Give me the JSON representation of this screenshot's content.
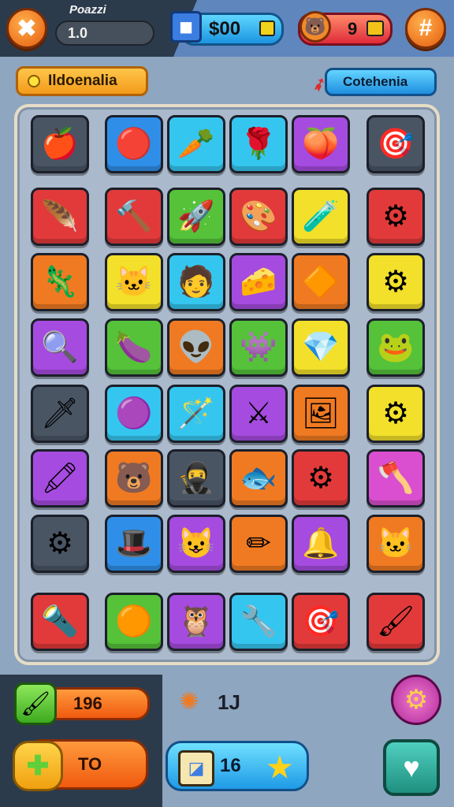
{
  "header": {
    "title": "Poazzi",
    "level_value": "1.0",
    "coins_value": "$00",
    "gems_value": "9",
    "left_button_icon": "crossed-swords-icon",
    "right_button_icon": "hash-settings-icon"
  },
  "labels": {
    "left_label": "Ildoenalia",
    "right_label": "Cotehenia"
  },
  "board": {
    "colors": {
      "red": "#e23a3a",
      "blue": "#2f8fe8",
      "cyan": "#35c6f0",
      "purple": "#a64be0",
      "green": "#55c23a",
      "yellow": "#f2e02a",
      "orange": "#f07a22",
      "gray": "#4a5564",
      "magenta": "#d94fd0"
    },
    "tiles": [
      {
        "color": "gray",
        "icon": "🍎",
        "name": "apple-icon"
      },
      {
        "color": "blue",
        "icon": "🔴",
        "name": "red-ball-icon"
      },
      {
        "color": "cyan",
        "icon": "🥕",
        "name": "carrot-brush-icon"
      },
      {
        "color": "cyan",
        "icon": "🌹",
        "name": "flower-icon"
      },
      {
        "color": "purple",
        "icon": "🍑",
        "name": "fruit-icon"
      },
      {
        "color": "gray",
        "icon": "🎯",
        "name": "target-icon"
      },
      {
        "color": "red",
        "icon": "🪶",
        "name": "feather-icon"
      },
      {
        "color": "red",
        "icon": "🔨",
        "name": "hammer-icon"
      },
      {
        "color": "green",
        "icon": "🚀",
        "name": "rocket-icon"
      },
      {
        "color": "red",
        "icon": "🎨",
        "name": "palette-icon"
      },
      {
        "color": "yellow",
        "icon": "🧪",
        "name": "potion-icon"
      },
      {
        "color": "red",
        "icon": "⚙",
        "name": "gear-icon"
      },
      {
        "color": "orange",
        "icon": "🦎",
        "name": "lizard-icon"
      },
      {
        "color": "yellow",
        "icon": "🐱",
        "name": "cat-icon"
      },
      {
        "color": "cyan",
        "icon": "🧑",
        "name": "person-icon"
      },
      {
        "color": "purple",
        "icon": "🧀",
        "name": "cheese-icon"
      },
      {
        "color": "orange",
        "icon": "🔶",
        "name": "gem-shape-icon"
      },
      {
        "color": "yellow",
        "icon": "⚙",
        "name": "blue-gear-icon"
      },
      {
        "color": "purple",
        "icon": "🔍",
        "name": "lens-icon"
      },
      {
        "color": "green",
        "icon": "🍆",
        "name": "eggplant-icon"
      },
      {
        "color": "orange",
        "icon": "👽",
        "name": "alien-icon"
      },
      {
        "color": "green",
        "icon": "👾",
        "name": "monster-icon"
      },
      {
        "color": "yellow",
        "icon": "💎",
        "name": "crystal-icon"
      },
      {
        "color": "green",
        "icon": "🐸",
        "name": "frog-icon"
      },
      {
        "color": "gray",
        "icon": "🗡",
        "name": "dagger-icon"
      },
      {
        "color": "cyan",
        "icon": "🟣",
        "name": "purple-orb-icon"
      },
      {
        "color": "cyan",
        "icon": "🪄",
        "name": "wand-icon"
      },
      {
        "color": "purple",
        "icon": "⚔",
        "name": "sword-icon"
      },
      {
        "color": "orange",
        "icon": "🖼",
        "name": "picture-icon"
      },
      {
        "color": "yellow",
        "icon": "⚙",
        "name": "dark-gear-icon"
      },
      {
        "color": "purple",
        "icon": "🖍",
        "name": "crayon-icon"
      },
      {
        "color": "orange",
        "icon": "🐻",
        "name": "bear-icon"
      },
      {
        "color": "gray",
        "icon": "🥷",
        "name": "ninja-icon"
      },
      {
        "color": "orange",
        "icon": "🐟",
        "name": "fish-icon"
      },
      {
        "color": "red",
        "icon": "⚙",
        "name": "cog-icon"
      },
      {
        "color": "magenta",
        "icon": "🪓",
        "name": "axe-icon"
      },
      {
        "color": "gray",
        "icon": "⚙",
        "name": "red-gear-icon"
      },
      {
        "color": "blue",
        "icon": "🎩",
        "name": "hat-icon"
      },
      {
        "color": "purple",
        "icon": "😺",
        "name": "purple-cat-icon"
      },
      {
        "color": "orange",
        "icon": "✏",
        "name": "pencil-icon"
      },
      {
        "color": "purple",
        "icon": "🔔",
        "name": "bell-icon"
      },
      {
        "color": "orange",
        "icon": "🐱",
        "name": "gray-cat-icon"
      },
      {
        "color": "red",
        "icon": "🔦",
        "name": "torch-icon"
      },
      {
        "color": "green",
        "icon": "🟠",
        "name": "orange-coin-icon"
      },
      {
        "color": "purple",
        "icon": "🦉",
        "name": "owl-icon"
      },
      {
        "color": "cyan",
        "icon": "🔧",
        "name": "wrench-icon"
      },
      {
        "color": "red",
        "icon": "🎯",
        "name": "orange-target-icon"
      },
      {
        "color": "red",
        "icon": "🖌",
        "name": "brush-icon"
      }
    ]
  },
  "footer": {
    "brush_count": "196",
    "puzzle_value": "TO",
    "moves_value": "1J",
    "stars_value": "16",
    "settings_icon": "gear-icon",
    "favorite_icon": "heart-icon"
  }
}
